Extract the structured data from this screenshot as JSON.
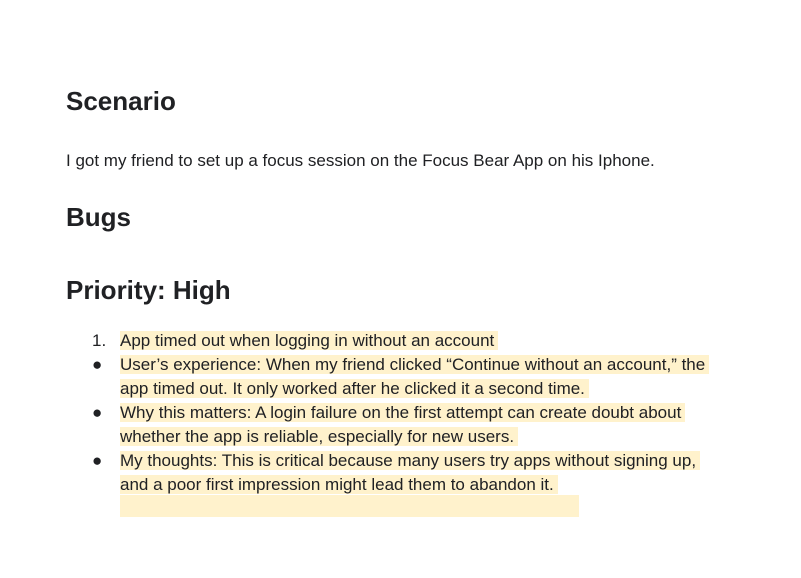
{
  "scenario": {
    "heading": "Scenario",
    "text": "I got my friend to set up a focus session on the Focus Bear App on his Iphone."
  },
  "bugs": {
    "heading": "Bugs"
  },
  "priority": {
    "heading": "Priority: High"
  },
  "list": {
    "item1": {
      "marker": "1.",
      "text": "App timed out when logging in without an account"
    },
    "item2": {
      "marker": "●",
      "line1": "User’s experience: When my friend clicked “Continue without an account,” the",
      "line2": "app timed out. It only worked after he clicked it a second time."
    },
    "item3": {
      "marker": "●",
      "line1": "Why this matters: A login failure on the first attempt can create doubt about",
      "line2": "whether the app is reliable, especially for new users."
    },
    "item4": {
      "marker": "●",
      "line1": "My thoughts: This is critical because many users try apps without signing up,",
      "line2": "and a poor first impression might lead them to abandon it."
    }
  },
  "colors": {
    "highlight": "#fff2cc",
    "text": "#202124"
  }
}
